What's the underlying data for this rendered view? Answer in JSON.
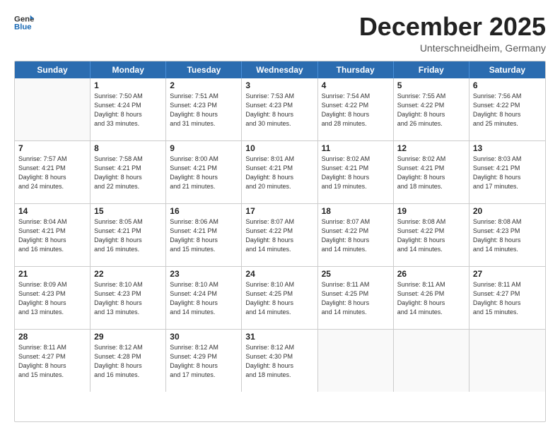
{
  "header": {
    "logo_line1": "General",
    "logo_line2": "Blue",
    "month": "December 2025",
    "location": "Unterschneidheim, Germany"
  },
  "days_of_week": [
    "Sunday",
    "Monday",
    "Tuesday",
    "Wednesday",
    "Thursday",
    "Friday",
    "Saturday"
  ],
  "weeks": [
    [
      {
        "day": "",
        "info": ""
      },
      {
        "day": "1",
        "info": "Sunrise: 7:50 AM\nSunset: 4:24 PM\nDaylight: 8 hours\nand 33 minutes."
      },
      {
        "day": "2",
        "info": "Sunrise: 7:51 AM\nSunset: 4:23 PM\nDaylight: 8 hours\nand 31 minutes."
      },
      {
        "day": "3",
        "info": "Sunrise: 7:53 AM\nSunset: 4:23 PM\nDaylight: 8 hours\nand 30 minutes."
      },
      {
        "day": "4",
        "info": "Sunrise: 7:54 AM\nSunset: 4:22 PM\nDaylight: 8 hours\nand 28 minutes."
      },
      {
        "day": "5",
        "info": "Sunrise: 7:55 AM\nSunset: 4:22 PM\nDaylight: 8 hours\nand 26 minutes."
      },
      {
        "day": "6",
        "info": "Sunrise: 7:56 AM\nSunset: 4:22 PM\nDaylight: 8 hours\nand 25 minutes."
      }
    ],
    [
      {
        "day": "7",
        "info": "Sunrise: 7:57 AM\nSunset: 4:21 PM\nDaylight: 8 hours\nand 24 minutes."
      },
      {
        "day": "8",
        "info": "Sunrise: 7:58 AM\nSunset: 4:21 PM\nDaylight: 8 hours\nand 22 minutes."
      },
      {
        "day": "9",
        "info": "Sunrise: 8:00 AM\nSunset: 4:21 PM\nDaylight: 8 hours\nand 21 minutes."
      },
      {
        "day": "10",
        "info": "Sunrise: 8:01 AM\nSunset: 4:21 PM\nDaylight: 8 hours\nand 20 minutes."
      },
      {
        "day": "11",
        "info": "Sunrise: 8:02 AM\nSunset: 4:21 PM\nDaylight: 8 hours\nand 19 minutes."
      },
      {
        "day": "12",
        "info": "Sunrise: 8:02 AM\nSunset: 4:21 PM\nDaylight: 8 hours\nand 18 minutes."
      },
      {
        "day": "13",
        "info": "Sunrise: 8:03 AM\nSunset: 4:21 PM\nDaylight: 8 hours\nand 17 minutes."
      }
    ],
    [
      {
        "day": "14",
        "info": "Sunrise: 8:04 AM\nSunset: 4:21 PM\nDaylight: 8 hours\nand 16 minutes."
      },
      {
        "day": "15",
        "info": "Sunrise: 8:05 AM\nSunset: 4:21 PM\nDaylight: 8 hours\nand 16 minutes."
      },
      {
        "day": "16",
        "info": "Sunrise: 8:06 AM\nSunset: 4:21 PM\nDaylight: 8 hours\nand 15 minutes."
      },
      {
        "day": "17",
        "info": "Sunrise: 8:07 AM\nSunset: 4:22 PM\nDaylight: 8 hours\nand 14 minutes."
      },
      {
        "day": "18",
        "info": "Sunrise: 8:07 AM\nSunset: 4:22 PM\nDaylight: 8 hours\nand 14 minutes."
      },
      {
        "day": "19",
        "info": "Sunrise: 8:08 AM\nSunset: 4:22 PM\nDaylight: 8 hours\nand 14 minutes."
      },
      {
        "day": "20",
        "info": "Sunrise: 8:08 AM\nSunset: 4:23 PM\nDaylight: 8 hours\nand 14 minutes."
      }
    ],
    [
      {
        "day": "21",
        "info": "Sunrise: 8:09 AM\nSunset: 4:23 PM\nDaylight: 8 hours\nand 13 minutes."
      },
      {
        "day": "22",
        "info": "Sunrise: 8:10 AM\nSunset: 4:23 PM\nDaylight: 8 hours\nand 13 minutes."
      },
      {
        "day": "23",
        "info": "Sunrise: 8:10 AM\nSunset: 4:24 PM\nDaylight: 8 hours\nand 14 minutes."
      },
      {
        "day": "24",
        "info": "Sunrise: 8:10 AM\nSunset: 4:25 PM\nDaylight: 8 hours\nand 14 minutes."
      },
      {
        "day": "25",
        "info": "Sunrise: 8:11 AM\nSunset: 4:25 PM\nDaylight: 8 hours\nand 14 minutes."
      },
      {
        "day": "26",
        "info": "Sunrise: 8:11 AM\nSunset: 4:26 PM\nDaylight: 8 hours\nand 14 minutes."
      },
      {
        "day": "27",
        "info": "Sunrise: 8:11 AM\nSunset: 4:27 PM\nDaylight: 8 hours\nand 15 minutes."
      }
    ],
    [
      {
        "day": "28",
        "info": "Sunrise: 8:11 AM\nSunset: 4:27 PM\nDaylight: 8 hours\nand 15 minutes."
      },
      {
        "day": "29",
        "info": "Sunrise: 8:12 AM\nSunset: 4:28 PM\nDaylight: 8 hours\nand 16 minutes."
      },
      {
        "day": "30",
        "info": "Sunrise: 8:12 AM\nSunset: 4:29 PM\nDaylight: 8 hours\nand 17 minutes."
      },
      {
        "day": "31",
        "info": "Sunrise: 8:12 AM\nSunset: 4:30 PM\nDaylight: 8 hours\nand 18 minutes."
      },
      {
        "day": "",
        "info": ""
      },
      {
        "day": "",
        "info": ""
      },
      {
        "day": "",
        "info": ""
      }
    ]
  ]
}
